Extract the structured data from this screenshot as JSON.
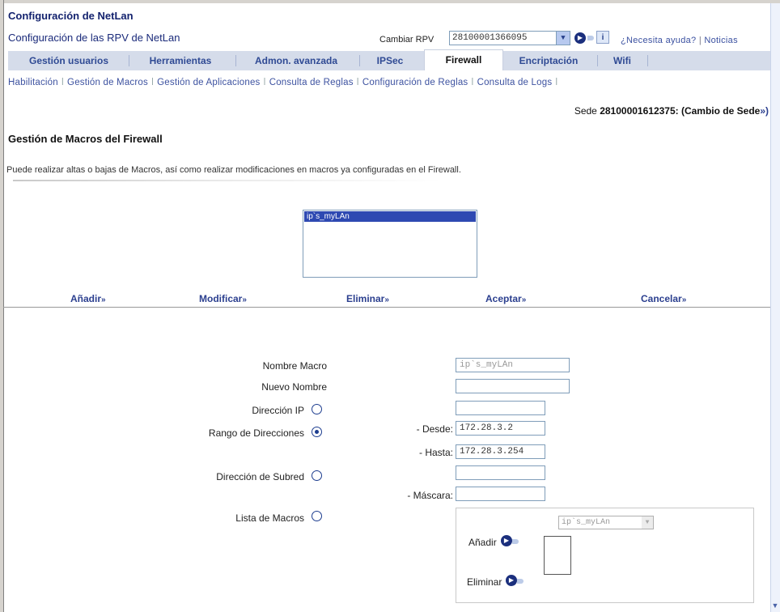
{
  "header": {
    "app_title": "Configuración de NetLan",
    "subtitle": "Configuración de las RPV de NetLan",
    "rpv_label": "Cambiar RPV",
    "rpv_value": "28100001366095",
    "help_text": "¿Necesita ayuda?",
    "news_text": "Noticias",
    "separator": "|"
  },
  "tabs": [
    {
      "label": "Gestión usuarios"
    },
    {
      "label": "Herramientas"
    },
    {
      "label": "Admon. avanzada"
    },
    {
      "label": "IPSec"
    },
    {
      "label": "Firewall",
      "active": true
    },
    {
      "label": "Encriptación"
    },
    {
      "label": "Wifi"
    }
  ],
  "subnav": [
    "Habilitación",
    "Gestión de Macros",
    "Gestión de Aplicaciones",
    "Consulta de Reglas",
    "Configuración de Reglas",
    "Consulta de Logs"
  ],
  "sede": {
    "label": "Sede",
    "id": "28100001612375",
    "change": ": (Cambio de Sede",
    "chev": "»)"
  },
  "section": {
    "title": "Gestión de Macros del Firewall",
    "description": "Puede realizar altas o bajas de Macros, así como realizar modificaciones en macros ya configuradas en el Firewall."
  },
  "macro_list": {
    "items": [
      "ip`s_myLAn"
    ]
  },
  "actions": {
    "add": "Añadir",
    "modify": "Modificar",
    "delete": "Eliminar",
    "accept": "Aceptar",
    "cancel": "Cancelar",
    "chev": "»"
  },
  "form": {
    "macro_name_label": "Nombre Macro",
    "macro_name_value": "ip`s_myLAn",
    "new_name_label": "Nuevo Nombre",
    "new_name_value": "",
    "ip_label": "Dirección IP",
    "ip_value": "",
    "range_label": "Rango de Direcciones",
    "from_label": "- Desde:",
    "from_value": "172.28.3.2",
    "to_label": "- Hasta:",
    "to_value": "172.28.3.254",
    "subnet_label": "Dirección de Subred",
    "subnet_value": "",
    "mask_label": "- Máscara:",
    "mask_value": "",
    "macro_list_label": "Lista de Macros",
    "selected_option": "range",
    "panel_select_value": "ip`s_myLAn",
    "panel_add": "Añadir",
    "panel_delete": "Eliminar"
  },
  "icons": {
    "go": "go-arrow-icon",
    "info": "info-icon",
    "dropdown": "chevron-down-icon"
  },
  "colors": {
    "brand": "#13226e",
    "tab_bar": "#d5dcea",
    "link": "#2b3f8f",
    "selection": "#2e49b2"
  }
}
